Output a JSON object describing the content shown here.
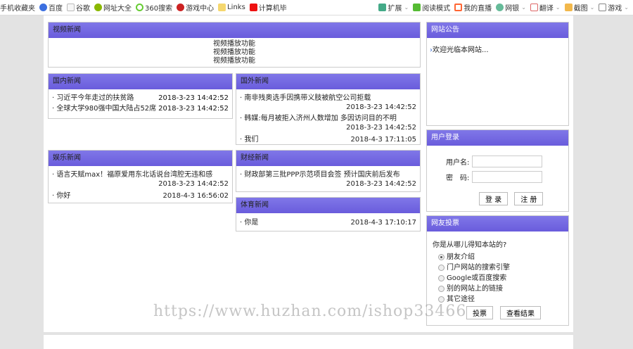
{
  "toolbar": {
    "left": [
      "手机收藏夹",
      "百度",
      "谷歌",
      "网址大全",
      "360搜索",
      "游戏中心",
      "Links",
      "计算机毕"
    ],
    "right": [
      "扩展",
      "阅读模式",
      "我的直播",
      "网银",
      "翻译",
      "截图",
      "游戏"
    ]
  },
  "video": {
    "title": "视频新闻",
    "lines": [
      "视频播放功能",
      "视频播放功能",
      "视频播放功能"
    ]
  },
  "domestic": {
    "title": "国内新闻",
    "items": [
      {
        "t": "习近平今年走过的扶贫路",
        "d": "2018-3-23 14:42:52"
      },
      {
        "t": "全球大学980强中国大陆占52席",
        "d": "2018-3-23 14:42:52"
      }
    ]
  },
  "foreign": {
    "title": "国外新闻",
    "items": [
      {
        "t": "南非残奥选手因携带义肢被航空公司拒载",
        "d": "2018-3-23 14:42:52"
      },
      {
        "t": "韩媒:每月被拒入济州人数增加 多因访问目的不明",
        "d": "2018-3-23 14:42:52"
      },
      {
        "t": "我们",
        "d": "2018-4-3 17:11:05"
      }
    ]
  },
  "ent": {
    "title": "娱乐新闻",
    "items": [
      {
        "t": "语言天赋max！福原爱用东北话说台湾腔无违和感",
        "d": "2018-3-23 14:42:52"
      },
      {
        "t": "你好",
        "d": "2018-4-3 16:56:02"
      }
    ]
  },
  "finance": {
    "title": "财经新闻",
    "items": [
      {
        "t": "财政部第三批PPP示范项目会签 预计国庆前后发布",
        "d": "2018-3-23 14:42:52"
      }
    ]
  },
  "sports": {
    "title": "体育新闻",
    "items": [
      {
        "t": "你是",
        "d": "2018-4-3 17:10:17"
      }
    ]
  },
  "notice": {
    "title": "网站公告",
    "text": "欢迎光临本网站..."
  },
  "login": {
    "title": "用户登录",
    "user_label": "用户名:",
    "pass_label": "密　码:",
    "login": "登 录",
    "register": "注 册"
  },
  "vote": {
    "title": "网友投票",
    "question": "你是从哪儿得知本站的?",
    "options": [
      "朋友介绍",
      "门户网站的搜索引擎",
      "Google或百度搜索",
      "别的网站上的链接",
      "其它途径"
    ],
    "submit": "投票",
    "results": "查看结果"
  },
  "watermark": "https://www.huzhan.com/ishop33466"
}
